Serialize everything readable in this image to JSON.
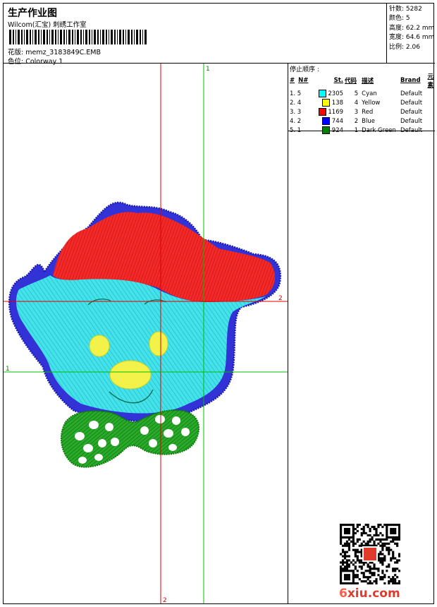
{
  "header": {
    "title": "生产作业图",
    "subtitle": "Wilcom(汇宝) 刺绣工作室",
    "pattern": "花版: memz_3183849C.EMB",
    "colorway": "色位: Colorway 1"
  },
  "stats": [
    {
      "label": "针数",
      "value": "5282"
    },
    {
      "label": "颜色",
      "value": "5"
    },
    {
      "label": "高度",
      "value": "62.2 mm"
    },
    {
      "label": "宽度",
      "value": "64.6 mm"
    },
    {
      "label": "比例",
      "value": "2.06"
    }
  ],
  "stop_sequence": {
    "title": "停止顺序 :",
    "columns": [
      "#",
      "N#",
      "St.",
      "代码",
      "描述",
      "Brand",
      "元素"
    ],
    "rows": [
      {
        "idx": "1. 5",
        "color": "#00ffff",
        "stitches": "2305",
        "code": "5",
        "desc": "Cyan",
        "brand": "Default"
      },
      {
        "idx": "2. 4",
        "color": "#ffff00",
        "stitches": "138",
        "code": "4",
        "desc": "Yellow",
        "brand": "Default"
      },
      {
        "idx": "3. 3",
        "color": "#ff0000",
        "stitches": "1169",
        "code": "3",
        "desc": "Red",
        "brand": "Default"
      },
      {
        "idx": "4. 2",
        "color": "#0000ff",
        "stitches": "744",
        "code": "2",
        "desc": "Blue",
        "brand": "Default"
      },
      {
        "idx": "5. 1",
        "color": "#008000",
        "stitches": "924",
        "code": "1",
        "desc": "Dark Green",
        "brand": "Default"
      }
    ]
  },
  "guides": {
    "v1": "1",
    "h2": "2",
    "h1": "1",
    "v2": "2"
  },
  "watermark": {
    "prefix": "6",
    "rest": "xiu.com"
  },
  "colors": {
    "cyan": "#3fe0e8",
    "red": "#f02020",
    "blue": "#2a2ad8",
    "green": "#1c9a1c",
    "yellow": "#f2f24a",
    "guide_red": "#e00000",
    "guide_green": "#00c000"
  }
}
